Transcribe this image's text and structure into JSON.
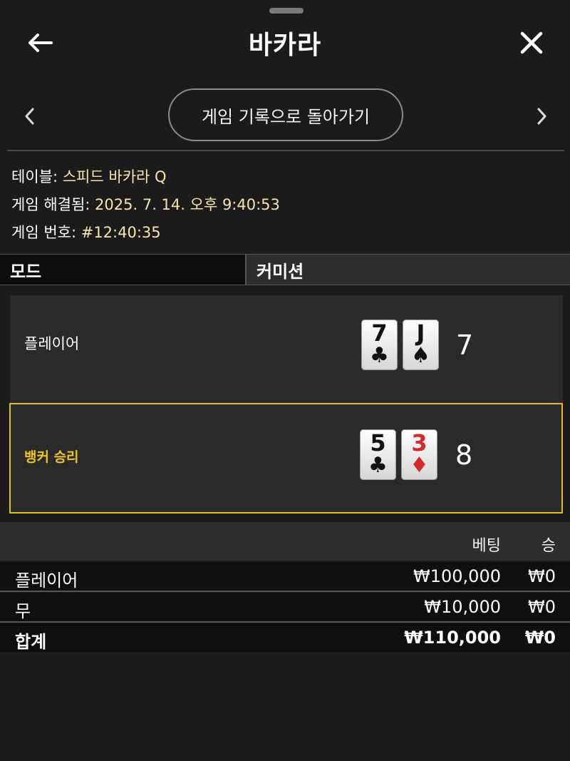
{
  "header": {
    "title": "바카라",
    "back_history_label": "게임 기록으로 돌아가기"
  },
  "info": {
    "table_label": "테이블:",
    "table_value": "스피드 바카라 Q",
    "resolved_label": "게임 해결됨:",
    "resolved_value": "2025. 7. 14. 오후 9:40:53",
    "game_no_label": "게임 번호:",
    "game_no_value": "#12:40:35"
  },
  "tabs": {
    "mode": "모드",
    "commission": "커미션"
  },
  "hands": {
    "player": {
      "label": "플레이어",
      "cards": [
        {
          "rank": "7",
          "suit": "♣"
        },
        {
          "rank": "J",
          "suit": "♠"
        }
      ],
      "score": "7"
    },
    "banker": {
      "label": "뱅커 승리",
      "cards": [
        {
          "rank": "5",
          "suit": "♣"
        },
        {
          "rank": "3",
          "suit": "♦"
        }
      ],
      "score": "8"
    }
  },
  "table": {
    "headers": {
      "bet": "베팅",
      "win": "승"
    },
    "rows": [
      {
        "name": "플레이어",
        "bet": "₩100,000",
        "win": "₩0"
      },
      {
        "name": "무",
        "bet": "₩10,000",
        "win": "₩0"
      }
    ],
    "total": {
      "name": "합계",
      "bet": "₩110,000",
      "win": "₩0"
    }
  },
  "colors": {
    "accent": "#f0c424",
    "info_value": "#f3e6ae",
    "background": "#1b1b1b"
  },
  "icons": {
    "back": "arrow-left-icon",
    "close": "close-icon",
    "prev": "chevron-left-icon",
    "next": "chevron-right-icon"
  }
}
